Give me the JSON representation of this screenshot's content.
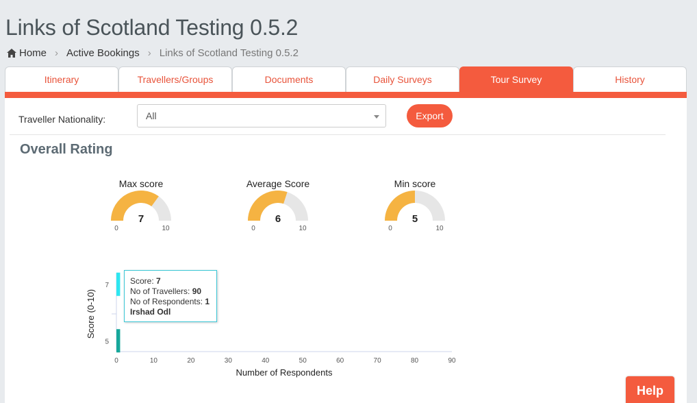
{
  "header": {
    "title": "Links of Scotland Testing 0.5.2",
    "breadcrumb": [
      "Home",
      "Active Bookings",
      "Links of Scotland Testing 0.5.2"
    ]
  },
  "tabs": [
    {
      "label": "Itinerary"
    },
    {
      "label": "Travellers/Groups"
    },
    {
      "label": "Documents"
    },
    {
      "label": "Daily Surveys"
    },
    {
      "label": "Tour Survey",
      "active": true
    },
    {
      "label": "History"
    }
  ],
  "filter": {
    "label": "Traveller Nationality:",
    "selected": "All",
    "export_label": "Export"
  },
  "overall": {
    "title": "Overall Rating",
    "gauges": [
      {
        "label": "Max score",
        "value": 7,
        "min": 0,
        "max": 10,
        "min_label": "0",
        "max_label": "10"
      },
      {
        "label": "Average Score",
        "value": 6,
        "min": 0,
        "max": 10,
        "min_label": "0",
        "max_label": "10"
      },
      {
        "label": "Min score",
        "value": 5,
        "min": 0,
        "max": 10,
        "min_label": "0",
        "max_label": "10"
      }
    ]
  },
  "chart_data": {
    "type": "bar",
    "orientation": "horizontal",
    "categories": [
      "7",
      "5"
    ],
    "values": [
      1,
      1
    ],
    "xlabel": "Number of Respondents",
    "ylabel": "Score (0-10)",
    "xlim": [
      0,
      90
    ],
    "xticks": [
      "0",
      "10",
      "20",
      "30",
      "40",
      "50",
      "60",
      "70",
      "80",
      "90"
    ],
    "colors": [
      "#2ee6f0",
      "#16a79a"
    ],
    "tooltip": {
      "score_label": "Score:",
      "score": "7",
      "travellers_label": "No of Travellers:",
      "travellers": "90",
      "respondents_label": "No of Respondents:",
      "respondents": "1",
      "name": "Irshad Odl"
    }
  },
  "help": {
    "label": "Help"
  },
  "colors": {
    "accent": "#f45b3e",
    "gauge_fill": "#f5b342",
    "gauge_track": "#e6e6e6"
  }
}
